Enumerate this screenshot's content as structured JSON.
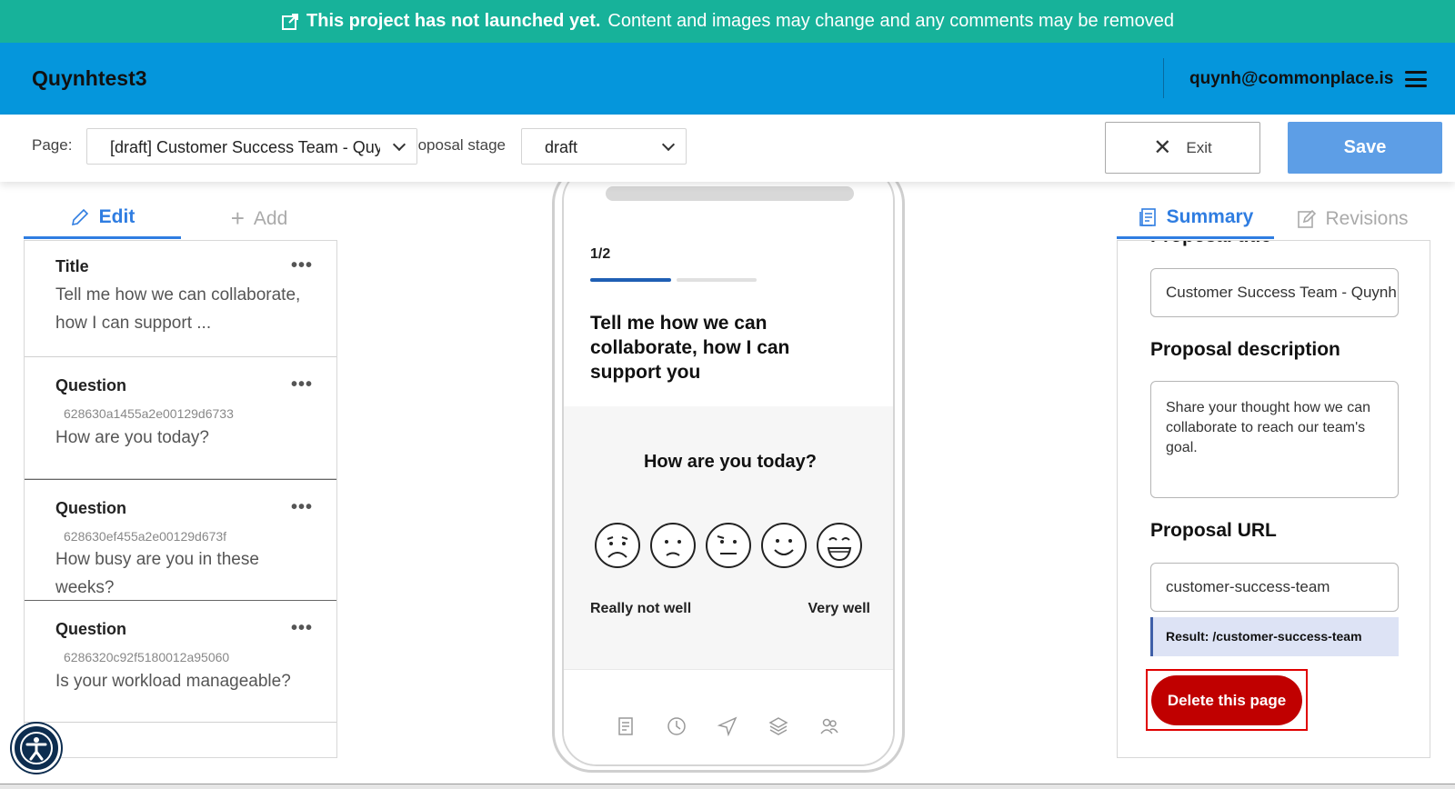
{
  "banner": {
    "bold_text": "This project has not launched yet.",
    "text": "Content and images may change and any comments may be removed"
  },
  "header": {
    "project_name": "Quynhtest3",
    "user_email": "quynh@commonplace.is"
  },
  "toolbar": {
    "page_label": "Page:",
    "page_value": "[draft] Customer Success Team - Quynh",
    "stage_label": "Proposal stage:",
    "stage_value": "draft",
    "exit_label": "Exit",
    "save_label": "Save"
  },
  "left_panel": {
    "tabs": [
      {
        "label": "Edit",
        "icon": "pencil-icon"
      },
      {
        "label": "Add",
        "icon": "plus-icon"
      }
    ],
    "cards": [
      {
        "type": "Title",
        "id": "",
        "text": "Tell me how we can collaborate, how I can support ..."
      },
      {
        "type": "Question",
        "id": "628630a1455a2e00129d6733",
        "text": "How are you today?"
      },
      {
        "type": "Question",
        "id": "628630ef455a2e00129d673f",
        "text": "How busy are you in these weeks?"
      },
      {
        "type": "Question",
        "id": "6286320c92f5180012a95060",
        "text": "Is your workload manageable?"
      }
    ],
    "more_label": "•••"
  },
  "phone": {
    "progress": "1/2",
    "progress_fraction": 0.5,
    "title": "Tell me how we can collaborate, how I can support you",
    "question": "How are you today?",
    "scale_low": "Really not well",
    "scale_high": "Very well",
    "faces": [
      "very-sad-face-icon",
      "sad-face-icon",
      "neutral-face-icon",
      "happy-face-icon",
      "very-happy-face-icon"
    ],
    "nav_icons": [
      "news-icon",
      "clock-icon",
      "send-icon",
      "layers-icon",
      "people-icon"
    ]
  },
  "right_panel": {
    "tabs": [
      {
        "label": "Summary",
        "icon": "document-icon"
      },
      {
        "label": "Revisions",
        "icon": "edit-document-icon"
      }
    ],
    "proposal_title_label": "Proposal title",
    "proposal_title_value": "Customer Success Team - Quynh",
    "proposal_description_label": "Proposal description",
    "proposal_description_value": "Share your thought how we can collaborate to reach our team's goal.",
    "proposal_url_label": "Proposal URL",
    "proposal_url_value": "customer-success-team",
    "result_text": "Result: /customer-success-team",
    "delete_label": "Delete this page"
  },
  "colors": {
    "banner": "#17b29a",
    "header": "#0596dc",
    "accent": "#2f7de1",
    "save": "#5d9ee6",
    "danger": "#c00000",
    "progress_active": "#1f5fb4"
  }
}
